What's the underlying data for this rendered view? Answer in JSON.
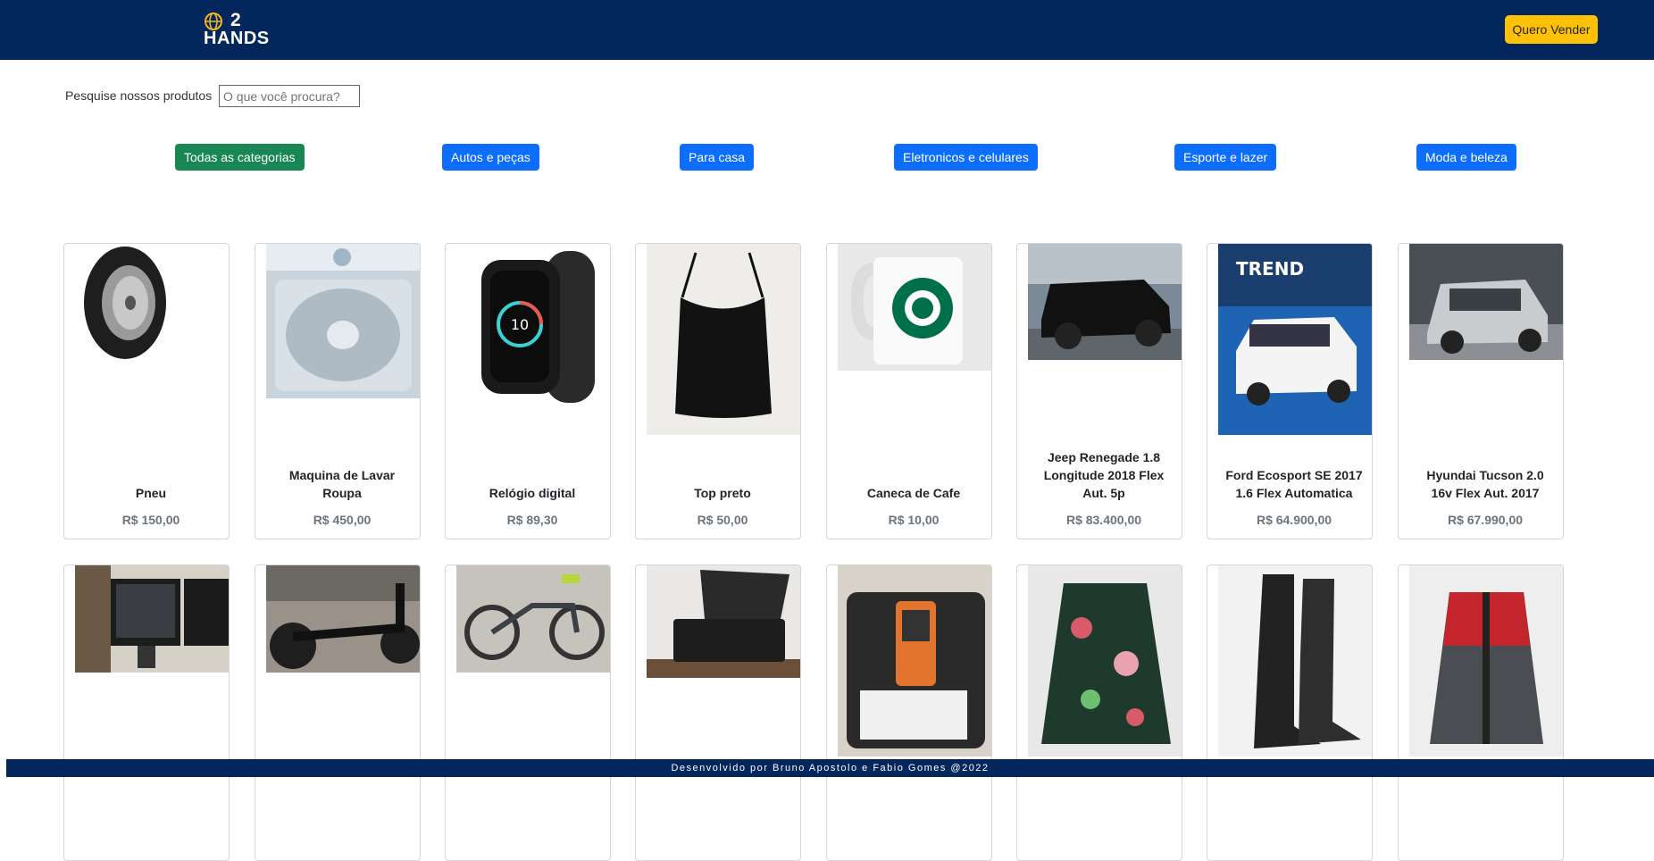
{
  "header": {
    "logo_line1": "2",
    "logo_line2": "HANDS",
    "sell_button": "Quero Vender"
  },
  "search": {
    "label": "Pesquise nossos produtos",
    "placeholder": "O que você procura?"
  },
  "categories": [
    {
      "label": "Todas as categorias",
      "active": true
    },
    {
      "label": "Autos e peças",
      "active": false
    },
    {
      "label": "Para casa",
      "active": false
    },
    {
      "label": "Eletronicos e celulares",
      "active": false
    },
    {
      "label": "Esporte e lazer",
      "active": false
    },
    {
      "label": "Moda e beleza",
      "active": false
    }
  ],
  "products": [
    {
      "title": "Pneu",
      "price": "R$ 150,00"
    },
    {
      "title": "Maquina de Lavar Roupa",
      "price": "R$ 450,00"
    },
    {
      "title": "Relógio digital",
      "price": "R$ 89,30"
    },
    {
      "title": "Top preto",
      "price": "R$ 50,00"
    },
    {
      "title": "Caneca de Cafe",
      "price": "R$ 10,00"
    },
    {
      "title": "Jeep Renegade 1.8 Longitude 2018 Flex Aut. 5p",
      "price": "R$ 83.400,00"
    },
    {
      "title": "Ford Ecosport SE 2017 1.6 Flex Automatica",
      "price": "R$ 64.900,00"
    },
    {
      "title": "Hyundai Tucson 2.0 16v Flex Aut. 2017",
      "price": "R$ 67.990,00"
    }
  ],
  "footer": {
    "text": "Desenvolvido por Bruno Apostolo e Fabio Gomes @2022"
  },
  "colors": {
    "navbar": "#03275c",
    "accent_yellow": "#ffc107",
    "primary_blue": "#0d6efd",
    "active_green": "#198754",
    "price_gray": "#6c757d"
  }
}
